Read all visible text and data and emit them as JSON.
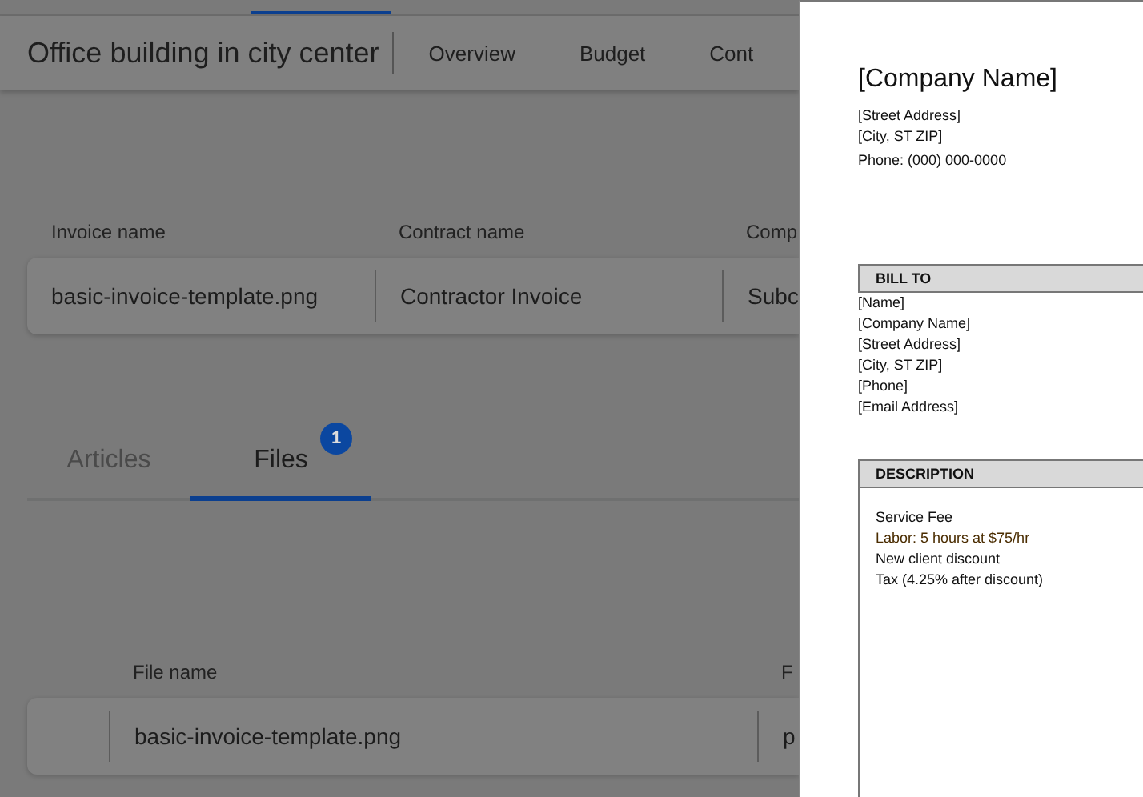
{
  "header": {
    "title": "Office building in city center",
    "nav": [
      {
        "label": "Overview",
        "selected": false
      },
      {
        "label": "Budget",
        "selected": false
      },
      {
        "label": "Cont",
        "selected": false
      }
    ]
  },
  "invoice_table": {
    "columns": [
      "Invoice name",
      "Contract name",
      "Comp"
    ],
    "rows": [
      [
        "basic-invoice-template.png",
        "Contractor Invoice",
        "Subc"
      ]
    ]
  },
  "tabs": [
    {
      "label": "Articles",
      "selected": false
    },
    {
      "label": "Files",
      "selected": true,
      "badge": "1"
    }
  ],
  "files_table": {
    "columns": [
      "File name",
      "F"
    ],
    "rows": [
      [
        "basic-invoice-template.png",
        "p"
      ]
    ]
  },
  "preview": {
    "company": "[Company Name]",
    "address": [
      "[Street Address]",
      "[City, ST  ZIP]",
      "Phone: (000) 000-0000"
    ],
    "bill_to": {
      "heading": "BILL TO",
      "lines": [
        "[Name]",
        "[Company Name]",
        "[Street Address]",
        "[City, ST  ZIP]",
        "[Phone]",
        "[Email Address]"
      ]
    },
    "description": {
      "heading": "DESCRIPTION",
      "lines": [
        "Service Fee",
        "Labor: 5 hours at $75/hr",
        "New client discount",
        "Tax (4.25% after discount)"
      ]
    }
  }
}
